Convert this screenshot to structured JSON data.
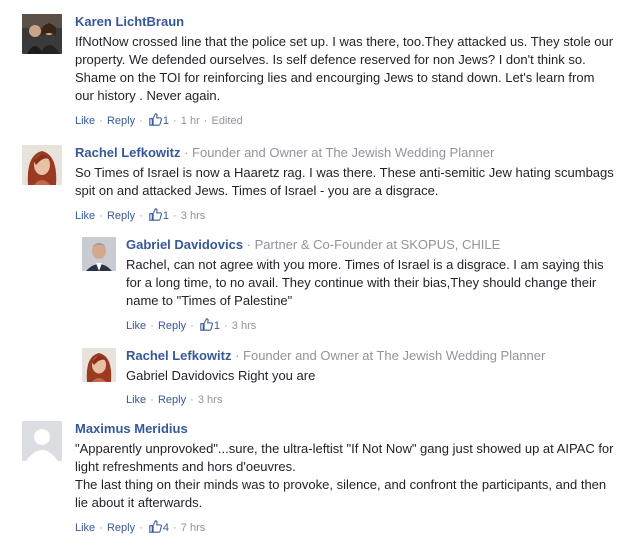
{
  "comments": [
    {
      "author": "Karen LichtBraun",
      "role": "",
      "text": "IfNotNow crossed line that the police set up. I was there, too.They attacked us. They stole our property. We defended ourselves. Is self defence reserved for non Jews? I don't think so. Shame on the TOI for reinforcing lies and encourging Jews to stand down. Let's learn from our history . Never again.",
      "like": "Like",
      "reply": "Reply",
      "likes": "1",
      "time": "1 hr",
      "edited": "Edited"
    },
    {
      "author": "Rachel Lefkowitz",
      "role": "Founder and Owner at The Jewish Wedding Planner",
      "text": "So Times of Israel is now a Haaretz rag. I was there. These anti-semitic Jew hating scumbags spit on and attacked Jews. Times of Israel - you are a disgrace.",
      "like": "Like",
      "reply": "Reply",
      "likes": "1",
      "time": "3 hrs"
    },
    {
      "author": "Gabriel Davidovics",
      "role": "Partner & Co-Founder at SKOPUS, CHILE",
      "text": "Rachel, can not agree with you more. Times of Israel is a disgrace. I am saying this for a long time, to no avail. They continue with their bias,They should change their name to \"Times of Palestine\"",
      "like": "Like",
      "reply": "Reply",
      "likes": "1",
      "time": "3 hrs"
    },
    {
      "author": "Rachel Lefkowitz",
      "role": "Founder and Owner at The Jewish Wedding Planner",
      "text": "Gabriel Davidovics Right you are",
      "like": "Like",
      "reply": "Reply",
      "time": "3 hrs"
    },
    {
      "author": "Maximus Meridius",
      "role": "",
      "text_lines": [
        "\"Apparently unprovoked\"...sure, the ultra-leftist \"If Not Now\" gang just showed up at AIPAC for light refreshments and hors d'oeuvres.",
        "The last thing on their minds was to provoke, silence, and confront the participants, and then lie about it afterwards."
      ],
      "like": "Like",
      "reply": "Reply",
      "likes": "4",
      "time": "7 hrs"
    }
  ],
  "colors": {
    "link": "#365899",
    "meta": "#90949c",
    "text": "#1d2129"
  },
  "icons": {
    "like": "thumbs-up-icon",
    "default_avatar": "default-avatar-icon"
  }
}
